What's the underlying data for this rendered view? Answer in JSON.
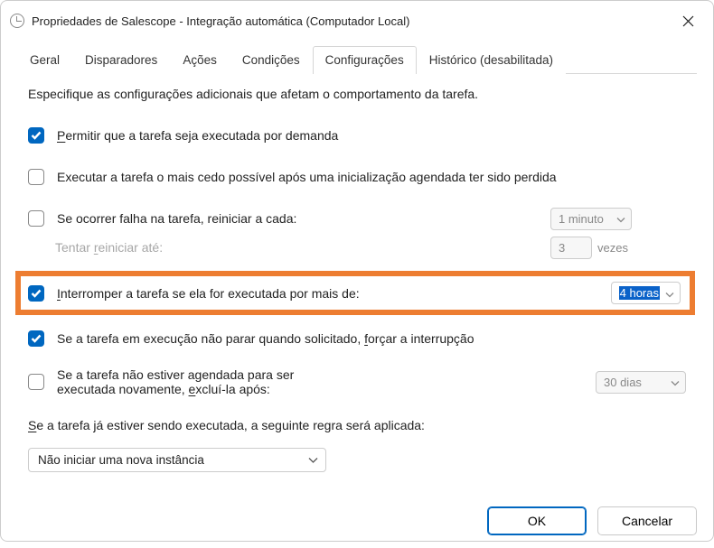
{
  "window": {
    "title": "Propriedades de Salescope - Integração automática (Computador Local)"
  },
  "tabs": {
    "items": [
      {
        "label": "Geral"
      },
      {
        "label": "Disparadores"
      },
      {
        "label": "Ações"
      },
      {
        "label": "Condições"
      },
      {
        "label": "Configurações"
      },
      {
        "label": "Histórico (desabilitada)"
      }
    ],
    "active_index": 4
  },
  "settings": {
    "description": "Especifique as configurações adicionais que afetam o comportamento da tarefa.",
    "allow_on_demand": {
      "checked": true,
      "prefix": "P",
      "label": "ermitir que a tarefa seja executada por demanda"
    },
    "run_asap_missed": {
      "checked": false,
      "label": "Executar a tarefa o mais cedo possível após uma inicialização agendada ter sido perdida"
    },
    "restart_on_fail": {
      "checked": false,
      "label": "Se ocorrer falha na tarefa, reiniciar a cada:",
      "interval": "1 minuto"
    },
    "retry_until": {
      "prefix": "Tentar ",
      "u": "r",
      "suffix": "einiciar até:",
      "count": "3",
      "unit": "vezes"
    },
    "stop_if_longer": {
      "checked": true,
      "prefix": "I",
      "label": "nterromper a tarefa se ela for executada por mais de:",
      "value": "4 horas"
    },
    "force_stop": {
      "checked": true,
      "prefix": "Se a tarefa em execução não parar quando solicitado, ",
      "u": "f",
      "suffix": "orçar a interrupção"
    },
    "delete_if_not_scheduled": {
      "checked": false,
      "prefix": "Se a tarefa não estiver agendada para ser executada novamente, ",
      "u": "e",
      "suffix": "xcluí-la após:",
      "value": "30 dias"
    },
    "already_running": {
      "prefix": "S",
      "label": "e a tarefa já estiver sendo executada, a seguinte regra será aplicada:",
      "value": "Não iniciar uma nova instância"
    }
  },
  "footer": {
    "ok": "OK",
    "cancel": "Cancelar"
  }
}
